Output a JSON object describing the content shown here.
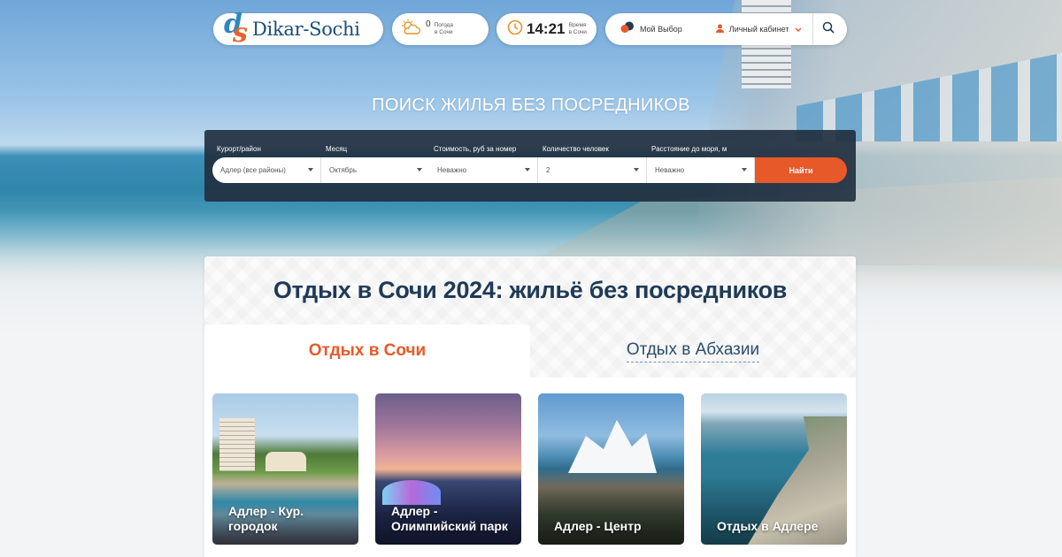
{
  "header": {
    "logo_text": "Dikar-Sochi",
    "logo_mark": [
      "d",
      "s"
    ],
    "weather": {
      "temp": "0",
      "label_line1": "Погода",
      "label_line2": "в Сочи",
      "icon": "cloud-sun-icon"
    },
    "clock": {
      "time": "14:21",
      "label_line1": "Время",
      "label_line2": "в Сочи",
      "icon": "clock-icon"
    },
    "my_choice": "Мой Выбор",
    "cabinet": "Личный кабинет",
    "search_icon": "search-icon"
  },
  "search": {
    "title": "ПОИСК ЖИЛЬЯ БЕЗ ПОСРЕДНИКОВ",
    "fields": [
      {
        "label": "Курорт/район",
        "value": "Адлер (все районы)"
      },
      {
        "label": "Месяц",
        "value": "Октябрь"
      },
      {
        "label": "Стоимость, руб за номер",
        "value": "Неважно"
      },
      {
        "label": "Количество человек",
        "value": "2"
      },
      {
        "label": "Расстояние до моря, м",
        "value": "Неважно"
      }
    ],
    "submit": "Найти"
  },
  "main": {
    "title": "Отдых в Сочи 2024: жильё без посредников",
    "tabs": [
      {
        "label": "Отдых в Сочи",
        "active": true
      },
      {
        "label": "Отдых в Абхазии",
        "active": false
      }
    ],
    "tiles": [
      {
        "line1": "Адлер - Кур.",
        "line2": "городок"
      },
      {
        "line1": "Адлер -",
        "line2": "Олимпийский парк"
      },
      {
        "line1": "Адлер - Центр",
        "line2": ""
      },
      {
        "line1": "Отдых в Адлере",
        "line2": ""
      }
    ]
  },
  "colors": {
    "accent": "#e8592a",
    "dark_panel": "#223040",
    "title": "#1f3a56",
    "brand_blue": "#1a4e78"
  }
}
